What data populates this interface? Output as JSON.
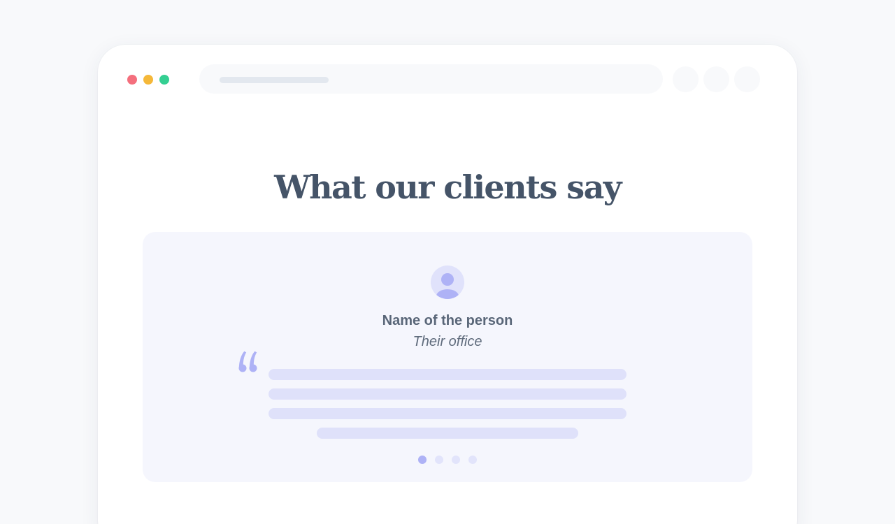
{
  "colors": {
    "page_background": "#f8f9fb",
    "browser_background": "#ffffff",
    "window_control_close": "#f46f7d",
    "window_control_minimize": "#f5b839",
    "window_control_maximize": "#34cf92",
    "heading": "#455468",
    "card_background": "#f5f6fd",
    "accent": "#aeb2f6",
    "placeholder_line": "#dfe1fa"
  },
  "browser_chrome": {
    "window_controls": [
      "close",
      "minimize",
      "maximize"
    ],
    "toolbar_buttons": [
      "toolbar-button-1",
      "toolbar-button-2",
      "toolbar-button-3"
    ]
  },
  "testimonials": {
    "title": "What our clients say",
    "card": {
      "avatar_icon": "user-avatar-icon",
      "name": "Name of the person",
      "office": "Their office",
      "quote_icon": "quote-mark-icon",
      "text_placeholder_lines": 4
    },
    "carousel": {
      "total": 4,
      "active_index": 0
    }
  }
}
